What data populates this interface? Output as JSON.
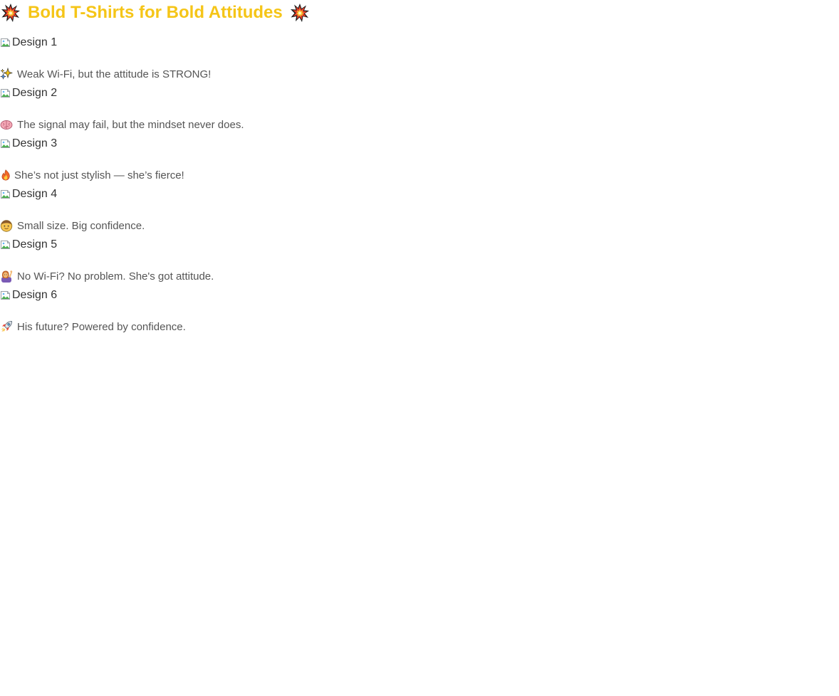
{
  "header": {
    "title": "Bold T-Shirts for Bold Attitudes",
    "title_color": "#F5C518",
    "leading_icon": "collision-icon",
    "trailing_icon": "collision-icon"
  },
  "designs": [
    {
      "image_alt": "Design 1",
      "icon": "sparkles-stars-icon",
      "caption": "Weak Wi-Fi, but the attitude is STRONG!"
    },
    {
      "image_alt": "Design 2",
      "icon": "brain-icon",
      "caption": "The signal may fail, but the mindset never does."
    },
    {
      "image_alt": "Design 3",
      "icon": "fire-icon",
      "caption": "She’s not just stylish — she’s fierce!"
    },
    {
      "image_alt": "Design 4",
      "icon": "boy-face-icon",
      "caption": "Small size. Big confidence."
    },
    {
      "image_alt": "Design 5",
      "icon": "woman-raising-hand-icon",
      "caption": "No Wi-Fi? No problem. She's got attitude."
    },
    {
      "image_alt": "Design 6",
      "icon": "rocket-icon",
      "caption": "His future? Powered by confidence."
    }
  ]
}
